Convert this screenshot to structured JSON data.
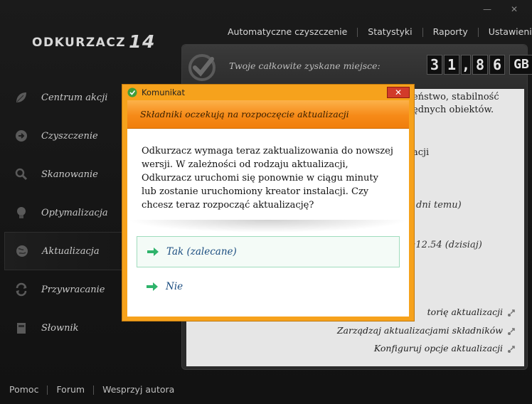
{
  "app": {
    "name": "Odkurzacz",
    "version": "14"
  },
  "window": {
    "minimize_label": "—",
    "close_label": "✕"
  },
  "topnav": {
    "items": [
      "Automatyczne czyszczenie",
      "Statystyki",
      "Raporty",
      "Ustawienia"
    ]
  },
  "sidebar": {
    "items": [
      {
        "label": "Centrum akcji",
        "icon": "leaf-icon"
      },
      {
        "label": "Czyszczenie",
        "icon": "arrow-circle-icon"
      },
      {
        "label": "Skanowanie",
        "icon": "magnifier-icon"
      },
      {
        "label": "Optymalizacja",
        "icon": "lightbulb-icon"
      },
      {
        "label": "Aktualizacja",
        "icon": "globe-icon",
        "active": true
      },
      {
        "label": "Przywracanie",
        "icon": "restore-icon"
      },
      {
        "label": "Słownik",
        "icon": "dictionary-icon"
      }
    ]
  },
  "panel": {
    "saved_label": "Twoje całkowite zyskane miejsce:",
    "counter": [
      "3",
      "1",
      ",",
      "8",
      "6"
    ],
    "counter_unit": "GB",
    "body_fragments": {
      "line1": "eństwo, stabilność",
      "line2": "ędnych obiektów.",
      "line3": "acji",
      "line4": "dni temu)",
      "line5": ":12.54  (dzisiaj)"
    },
    "links": [
      "torię aktualizacji",
      "Zarządzaj aktualizacjami składników",
      "Konfiguruj opcje aktualizacji"
    ]
  },
  "footer": {
    "items": [
      "Pomoc",
      "Forum",
      "Wesprzyj autora"
    ]
  },
  "dialog": {
    "title": "Komunikat",
    "close_label": "✕",
    "heading": "Składniki oczekują na rozpoczęcie aktualizacji",
    "message_lines": [
      "Odkurzacz wymaga teraz zaktualizowania do nowszej",
      "wersji. W zależności od rodzaju aktualizacji,",
      "Odkurzacz uruchomi się ponownie w ciągu minuty",
      "lub zostanie uruchomiony kreator instalacji. Czy",
      "chcesz teraz rozpocząć aktualizację?"
    ],
    "options": [
      {
        "label": "Tak (zalecane)",
        "selected": true
      },
      {
        "label": "Nie",
        "selected": false
      }
    ]
  },
  "colors": {
    "dialog_border": "#f6a21c",
    "dialog_header": "#f68a18",
    "option_text": "#1b4d80",
    "option_arrow": "#2fb36b",
    "close_button": "#d23b2a"
  }
}
